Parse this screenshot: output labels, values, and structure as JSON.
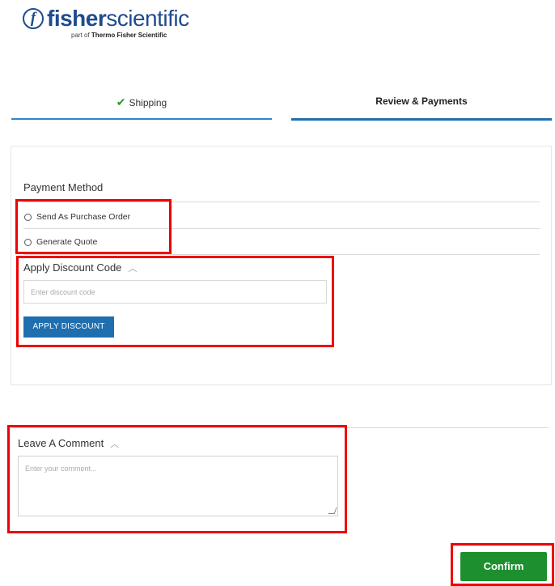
{
  "brand": {
    "name_bold": "fisher",
    "name_light": "scientific",
    "tag_prefix": "part of",
    "tag_bold": "Thermo Fisher Scientific",
    "color": "#1f4b8f"
  },
  "tabs": [
    {
      "label": "Shipping",
      "status": "completed",
      "icon": "check-icon"
    },
    {
      "label": "Review & Payments",
      "status": "active"
    }
  ],
  "payment": {
    "title": "Payment Method",
    "options": [
      {
        "label": "Send As Purchase Order",
        "selected": false
      },
      {
        "label": "Generate Quote",
        "selected": false
      }
    ]
  },
  "discount": {
    "title": "Apply Discount Code",
    "placeholder": "Enter discount code",
    "button_label": "APPLY DISCOUNT",
    "button_color": "#1f6fb0"
  },
  "comment": {
    "title": "Leave A Comment",
    "placeholder": "Enter your comment..."
  },
  "confirm": {
    "label": "Confirm",
    "color": "#1e8f2e"
  },
  "annotation_color": "#ee0000"
}
